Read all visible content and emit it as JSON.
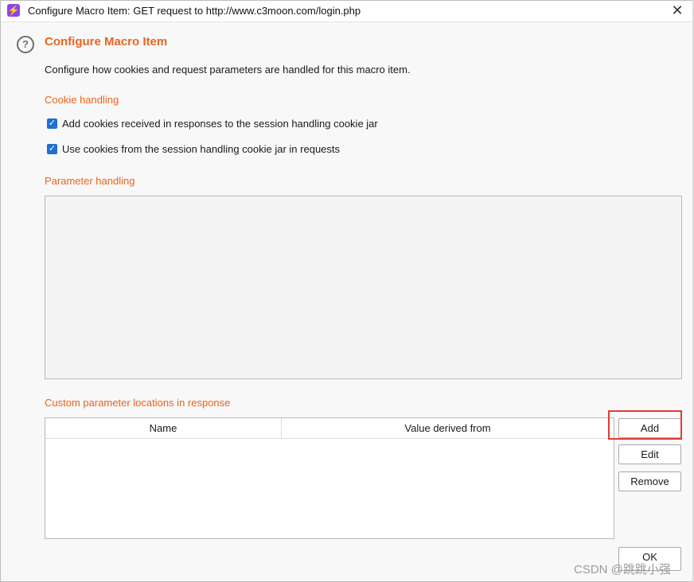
{
  "window": {
    "title": "Configure Macro Item: GET request to http://www.c3moon.com/login.php",
    "app_icon": "lightning-icon",
    "close_glyph": "✕"
  },
  "header": {
    "help_glyph": "?",
    "title": "Configure Macro Item",
    "description": "Configure how cookies and request parameters are handled for this macro item."
  },
  "cookie_handling": {
    "label": "Cookie handling",
    "options": [
      {
        "label": "Add cookies received in responses to the session handling cookie jar",
        "checked": true
      },
      {
        "label": "Use cookies from the session handling cookie jar in requests",
        "checked": true
      }
    ]
  },
  "parameter_handling": {
    "label": "Parameter handling"
  },
  "custom_locations": {
    "label": "Custom parameter locations in response",
    "columns": [
      "Name",
      "Value derived from"
    ],
    "rows": []
  },
  "buttons": {
    "add": "Add",
    "edit": "Edit",
    "remove": "Remove",
    "ok": "OK"
  },
  "watermark": "CSDN @跳跳小强",
  "colors": {
    "accent": "#e8641f",
    "checkbox": "#1f6fd0",
    "highlight": "#e53935"
  }
}
